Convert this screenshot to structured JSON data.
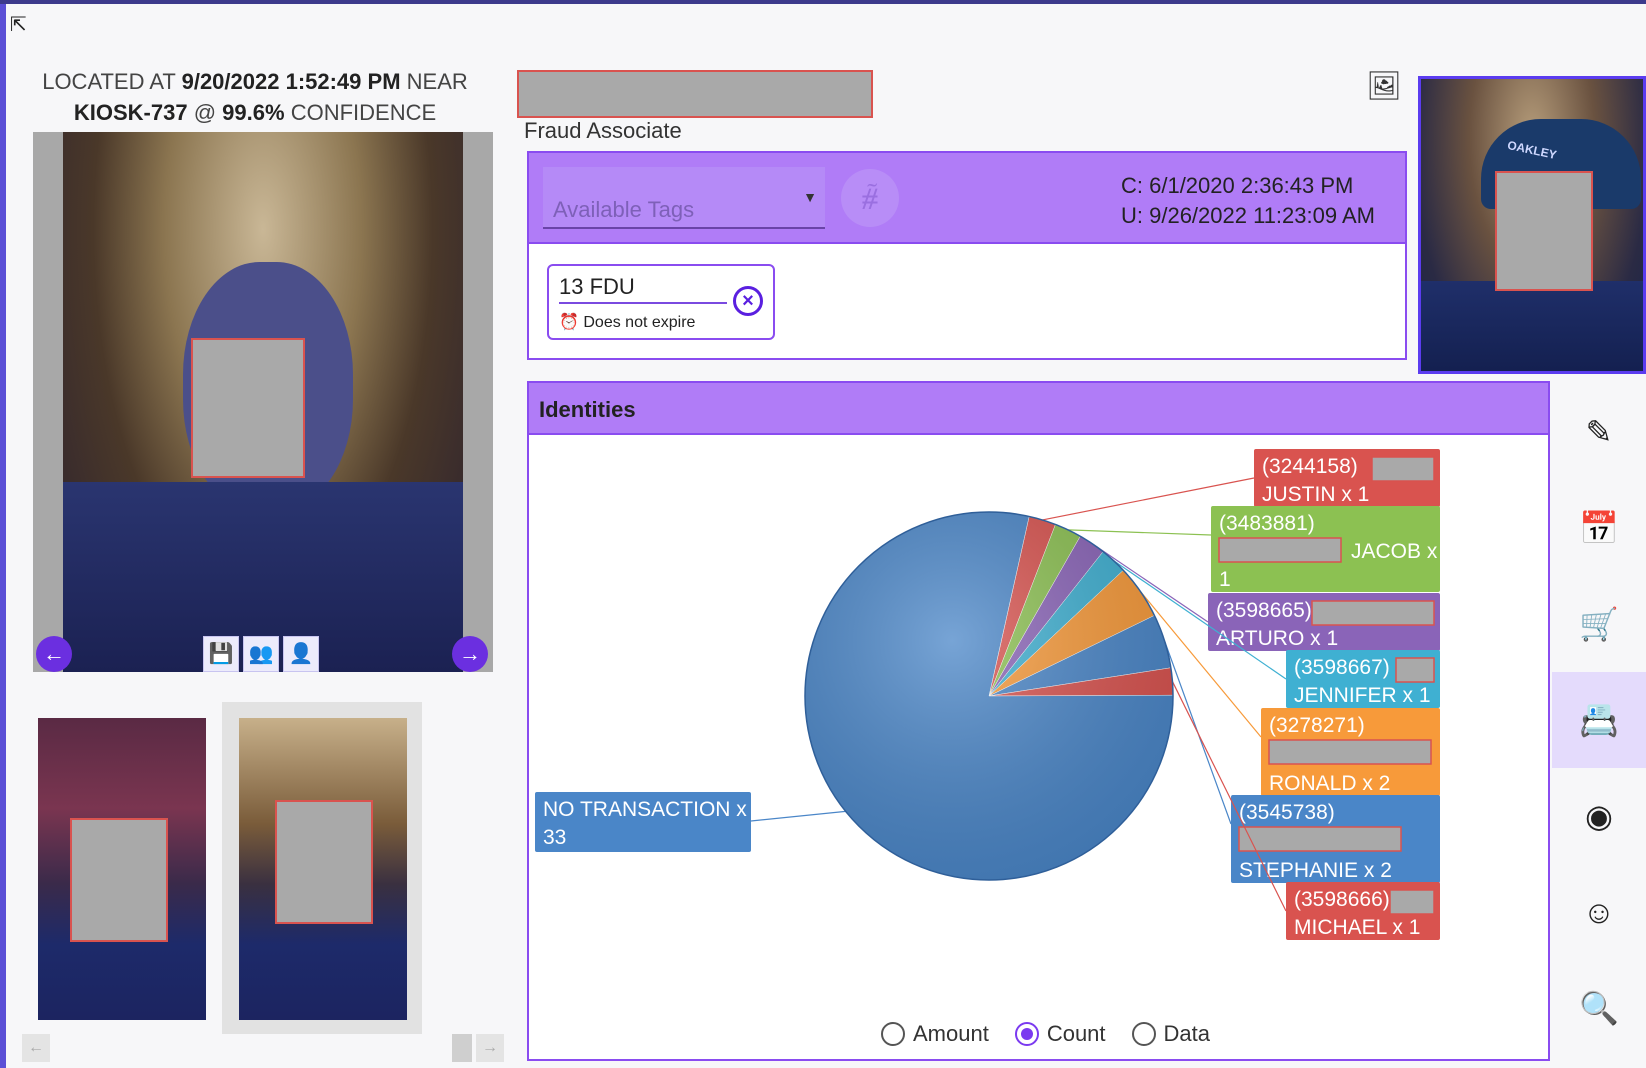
{
  "caption": {
    "prefix": "LOCATED AT",
    "datetime": "9/20/2022 1:52:49 PM",
    "near": "NEAR",
    "location": "KIOSK-737",
    "at": "@",
    "confidence": "99.6%",
    "confidence_word": "CONFIDENCE"
  },
  "profile": {
    "subtitle": "Fraud Associate"
  },
  "tags": {
    "placeholder": "Available Tags",
    "created": "C: 6/1/2020 2:36:43 PM",
    "updated": "U: 9/26/2022 11:23:09 AM",
    "chip_label": "13 FDU",
    "chip_expiry": "Does not expire"
  },
  "identities": {
    "title": "Identities",
    "chart_options": [
      "Amount",
      "Count",
      "Data"
    ],
    "selected_option": "Count"
  },
  "icons": {
    "collapse": "collapse-arrow-icon",
    "prev": "arrow-left-icon",
    "next": "arrow-right-icon",
    "save": "save-icon",
    "person_search": "person-search-icon",
    "badge": "id-badge-icon",
    "compare": "image-compare-icon",
    "tag_add": "tag-add-icon",
    "clock": "alarm-clock-icon",
    "remove": "close-circle-icon",
    "rail": [
      "person-edit-icon",
      "calendar-icon",
      "cart-icon",
      "contact-card-icon",
      "location-pin-icon",
      "face-scan-icon",
      "document-search-icon"
    ]
  },
  "colors": {
    "accent": "#8a4cf0",
    "panel": "#b07cf7",
    "nav": "#6b2fe0"
  },
  "chart_data": {
    "type": "pie",
    "title": "",
    "slices": [
      {
        "label_top": "(3244158)",
        "label_bottom": "JUSTIN x 1",
        "value": 1,
        "color": "#d9534f"
      },
      {
        "label_top": "(3483881)",
        "label_bottom": "JACOB x",
        "label_tail": "1",
        "value": 1,
        "color": "#8cc152"
      },
      {
        "label_top": "(3598665)",
        "label_bottom": "ARTURO x 1",
        "value": 1,
        "color": "#8a64b8"
      },
      {
        "label_top": "(3598667)",
        "label_bottom": "JENNIFER x 1",
        "value": 1,
        "color": "#3fb0d2"
      },
      {
        "label_top": "(3278271)",
        "label_bottom": "RONALD x 2",
        "value": 2,
        "color": "#f79a3a"
      },
      {
        "label_top": "(3545738)",
        "label_bottom": "STEPHANIE x 2",
        "value": 2,
        "color": "#4a86c8"
      },
      {
        "label_top": "(3598666)",
        "label_bottom": "MICHAEL x 1",
        "value": 1,
        "color": "#d9534f"
      },
      {
        "label_top": "NO TRANSACTION x",
        "label_bottom": "33",
        "value": 33,
        "color": "#4a86c8"
      }
    ]
  }
}
